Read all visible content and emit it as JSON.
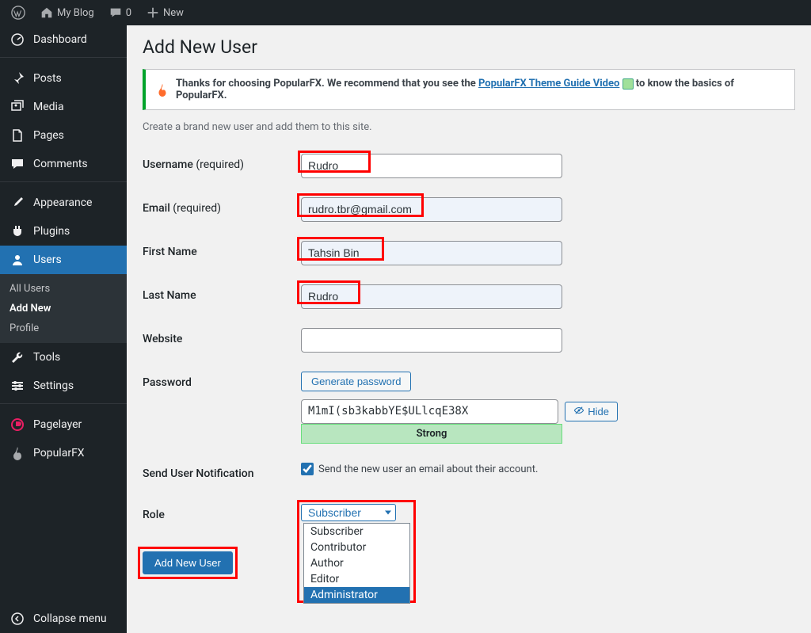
{
  "topbar": {
    "site_name": "My Blog",
    "comment_count": "0",
    "new_label": "New"
  },
  "sidebar": {
    "items": [
      {
        "id": "dashboard",
        "label": "Dashboard"
      },
      {
        "id": "posts",
        "label": "Posts"
      },
      {
        "id": "media",
        "label": "Media"
      },
      {
        "id": "pages",
        "label": "Pages"
      },
      {
        "id": "comments",
        "label": "Comments"
      },
      {
        "id": "appearance",
        "label": "Appearance"
      },
      {
        "id": "plugins",
        "label": "Plugins"
      },
      {
        "id": "users",
        "label": "Users"
      },
      {
        "id": "tools",
        "label": "Tools"
      },
      {
        "id": "settings",
        "label": "Settings"
      },
      {
        "id": "pagelayer",
        "label": "Pagelayer"
      },
      {
        "id": "popularfx",
        "label": "PopularFX"
      },
      {
        "id": "collapse",
        "label": "Collapse menu"
      }
    ],
    "users_sub": [
      {
        "label": "All Users",
        "current": false
      },
      {
        "label": "Add New",
        "current": true
      },
      {
        "label": "Profile",
        "current": false
      }
    ]
  },
  "page": {
    "title": "Add New User",
    "notice_pre": "Thanks for choosing PopularFX. We recommend that you see the ",
    "notice_link": "PopularFX Theme Guide Video",
    "notice_post": " to know the basics of PopularFX.",
    "description": "Create a brand new user and add them to this site."
  },
  "form": {
    "username": {
      "label": "Username",
      "req": "(required)",
      "value": "Rudro"
    },
    "email": {
      "label": "Email",
      "req": "(required)",
      "value": "rudro.tbr@gmail.com"
    },
    "first_name": {
      "label": "First Name",
      "value": "Tahsin Bin"
    },
    "last_name": {
      "label": "Last Name",
      "value": "Rudro"
    },
    "website": {
      "label": "Website",
      "value": ""
    },
    "password": {
      "label": "Password",
      "generate": "Generate password",
      "value": "M1mI(sb3kabbYE$ULlcqE38X",
      "hide": "Hide",
      "strength": "Strong"
    },
    "notify": {
      "label": "Send User Notification",
      "checkbox_label": "Send the new user an email about their account.",
      "checked": true
    },
    "role": {
      "label": "Role",
      "selected": "Subscriber",
      "options": [
        "Subscriber",
        "Contributor",
        "Author",
        "Editor",
        "Administrator"
      ],
      "highlighted": "Administrator"
    },
    "submit": "Add New User"
  }
}
